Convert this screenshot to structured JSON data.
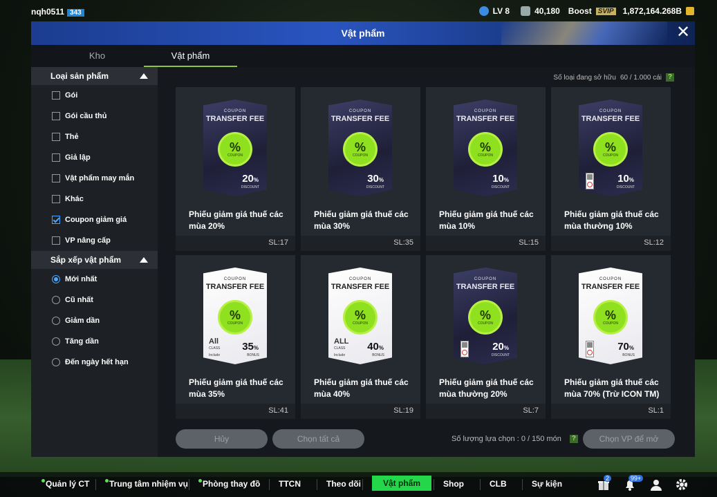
{
  "topbar": {
    "username": "nqh0511",
    "user_level": "343",
    "lv": "LV 8",
    "points": "40,180",
    "boost": "Boost",
    "svip": "SVIP",
    "currency": "1,872,164.268B"
  },
  "panel": {
    "title": "Vật phẩm",
    "close_icon": "close-icon"
  },
  "tabs": [
    {
      "label": "Kho"
    },
    {
      "label": "Vật phẩm"
    }
  ],
  "sidebar": {
    "types_header": "Loại sản phẩm",
    "types": [
      {
        "label": "Gói",
        "checked": false
      },
      {
        "label": "Gói cầu thủ",
        "checked": false
      },
      {
        "label": "Thẻ",
        "checked": false
      },
      {
        "label": "Giả lập",
        "checked": false
      },
      {
        "label": "Vật phẩm may mắn",
        "checked": false
      },
      {
        "label": "Khác",
        "checked": false
      },
      {
        "label": "Coupon giảm giá",
        "checked": true
      },
      {
        "label": "VP nâng cấp",
        "checked": false
      }
    ],
    "sort_header": "Sắp xếp vật phẩm",
    "sorts": [
      {
        "label": "Mới nhất",
        "selected": true
      },
      {
        "label": "Cũ nhất",
        "selected": false
      },
      {
        "label": "Giảm dần",
        "selected": false
      },
      {
        "label": "Tăng dần",
        "selected": false
      },
      {
        "label": "Đến ngày hết hạn",
        "selected": false
      }
    ]
  },
  "owned": {
    "label": "Số loại đang sở hữu",
    "value": "60 / 1.000 cái",
    "help": "?"
  },
  "coupon_text": {
    "small": "COUPON",
    "big": "TRANSFER FEE",
    "badge_pct": "%",
    "badge_sub": "COUPON"
  },
  "items": [
    {
      "name": "Phiếu giảm giá thuế các mùa 20%",
      "qty": "SL:17",
      "pct": "20",
      "pct_sign": "%",
      "type": "DISCOUNT",
      "style": "dark",
      "restricted": false,
      "all_class": false
    },
    {
      "name": "Phiếu giảm giá thuế các mùa 30%",
      "qty": "SL:35",
      "pct": "30",
      "pct_sign": "%",
      "type": "DISCOUNT",
      "style": "dark",
      "restricted": false,
      "all_class": false
    },
    {
      "name": "Phiếu giảm giá thuế các mùa 10%",
      "qty": "SL:15",
      "pct": "10",
      "pct_sign": "%",
      "type": "DISCOUNT",
      "style": "dark",
      "restricted": false,
      "all_class": false
    },
    {
      "name": "Phiếu giảm giá thuế các mùa thường 10%",
      "qty": "SL:12",
      "pct": "10",
      "pct_sign": "%",
      "type": "DISCOUNT",
      "style": "dark",
      "restricted": true,
      "all_class": false
    },
    {
      "name": "Phiếu giảm giá thuế các mùa 35%",
      "qty": "SL:41",
      "pct": "35",
      "pct_sign": "%",
      "type": "BONUS",
      "style": "white",
      "restricted": false,
      "all_class": true,
      "all_label": "All",
      "class_label": "CLASS",
      "include_label": "Include"
    },
    {
      "name": "Phiếu giảm giá thuế các mùa 40%",
      "qty": "SL:19",
      "pct": "40",
      "pct_sign": "%",
      "type": "BONUS",
      "style": "white",
      "restricted": false,
      "all_class": true,
      "all_label": "ALL",
      "class_label": "CLASS",
      "include_label": "Include"
    },
    {
      "name": "Phiếu giảm giá thuế các mùa thường 20%",
      "qty": "SL:7",
      "pct": "20",
      "pct_sign": "%",
      "type": "DISCOUNT",
      "style": "dark",
      "restricted": true,
      "all_class": false
    },
    {
      "name": "Phiếu giảm giá thuế các mùa 70% (Trừ ICON TM)",
      "qty": "SL:1",
      "pct": "70",
      "pct_sign": "%",
      "type": "BONUS",
      "style": "white",
      "restricted": true,
      "all_class": false
    }
  ],
  "actions": {
    "cancel": "Hủy",
    "select_all": "Chọn tất cả",
    "select_count": "Số lượng lựa chọn : 0 / 150 món",
    "help": "?",
    "choose": "Chọn VP để mở"
  },
  "bottom_nav": [
    {
      "label": "Quản lý CT",
      "dot": true
    },
    {
      "label": "Trung tâm nhiệm vụ",
      "dot": true
    },
    {
      "label": "Phòng thay đồ",
      "dot": true
    },
    {
      "label": "TTCN",
      "dot": false
    },
    {
      "label": "Theo dõi",
      "dot": false
    },
    {
      "label": "Vật phẩm",
      "dot": false,
      "active": true
    },
    {
      "label": "Shop",
      "dot": false
    },
    {
      "label": "CLB",
      "dot": false
    },
    {
      "label": "Sự kiện",
      "dot": false
    }
  ],
  "bottom_icons": {
    "box_badge": "2",
    "bell_badge": "99+",
    "icons": [
      "gift-box-icon",
      "bell-icon",
      "profile-icon",
      "gear-icon"
    ]
  },
  "colors": {
    "accent": "#23d64a",
    "header_blue": "#2a55c0",
    "coupon_green": "#8fe01f",
    "check_blue": "#4aa6ff"
  }
}
